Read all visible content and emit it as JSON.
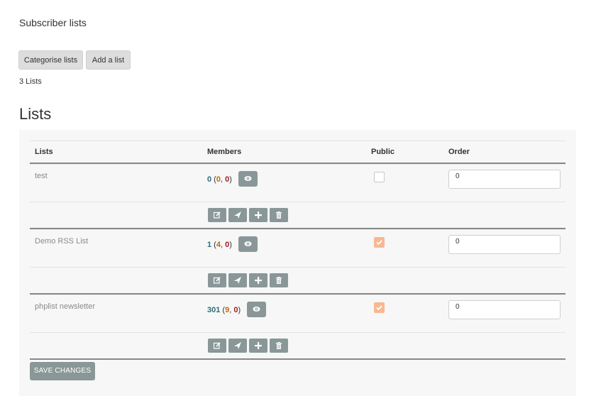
{
  "page": {
    "heading": "Subscriber lists"
  },
  "toolbar": {
    "categorise_label": "Categorise lists",
    "add_label": "Add a list"
  },
  "summary": {
    "count_text": "3 Lists"
  },
  "section": {
    "title": "Lists"
  },
  "table": {
    "headers": {
      "lists": "Lists",
      "members": "Members",
      "public": "Public",
      "order": "Order"
    },
    "rows": [
      {
        "name": "test",
        "members_total": "0",
        "members_a": "0",
        "members_b": "0",
        "public": false,
        "order": "0"
      },
      {
        "name": "Demo RSS List",
        "members_total": "1",
        "members_a": "4",
        "members_b": "0",
        "public": true,
        "order": "0"
      },
      {
        "name": "phplist newsletter",
        "members_total": "301",
        "members_a": "9",
        "members_b": "0",
        "public": true,
        "order": "0"
      }
    ]
  },
  "icons": {
    "view": "eye-icon",
    "edit": "edit-icon",
    "send": "send-icon",
    "add": "plus-icon",
    "delete": "trash-icon",
    "check": "check-icon"
  },
  "colors": {
    "button_gray": "#8a9798",
    "checkbox_checked": "#f7b892",
    "members_total": "#2c6e78",
    "members_a": "#c06a00",
    "members_b": "#a01e1e"
  },
  "footer": {
    "save_label": "SAVE CHANGES"
  }
}
